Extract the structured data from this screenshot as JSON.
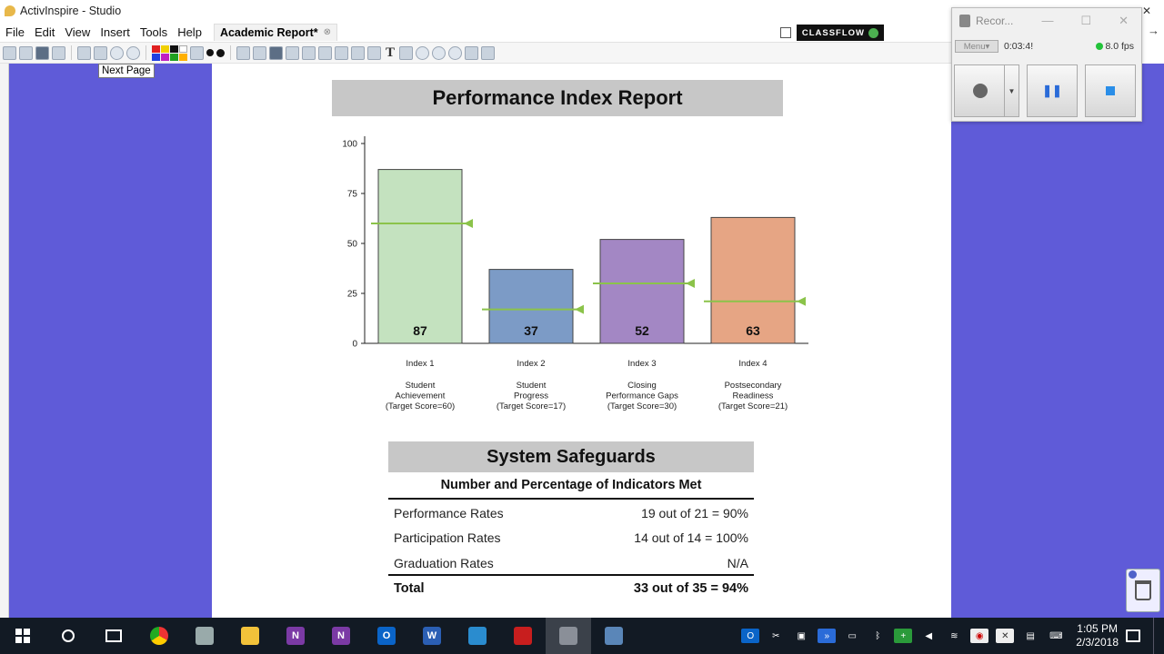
{
  "window": {
    "title": "ActivInspire - Studio"
  },
  "menu": {
    "items": [
      "File",
      "Edit",
      "View",
      "Insert",
      "Tools",
      "Help"
    ],
    "doc_tab": "Academic Report*",
    "classflow": "CLASSFLOW"
  },
  "tooltip": "Next Page",
  "report": {
    "title": "Performance Index Report"
  },
  "chart_data": {
    "type": "bar",
    "title": "Performance Index Report",
    "ylim": [
      0,
      100
    ],
    "yticks": [
      0,
      25,
      50,
      75,
      100
    ],
    "categories": [
      [
        "Index 1",
        "Student",
        "Achievement",
        "(Target Score=60)"
      ],
      [
        "Index 2",
        "Student",
        "Progress",
        "(Target Score=17)"
      ],
      [
        "Index 3",
        "Closing",
        "Performance Gaps",
        "(Target Score=30)"
      ],
      [
        "Index 4",
        "Postsecondary",
        "Readiness",
        "(Target Score=21)"
      ]
    ],
    "values": [
      87,
      37,
      52,
      63
    ],
    "targets": [
      60,
      17,
      30,
      21
    ],
    "colors": [
      "#c4e2bf",
      "#7c9bc6",
      "#a387c4",
      "#e6a584"
    ],
    "target_color": "#8bc34a",
    "grid": false
  },
  "safeguards": {
    "title": "System Safeguards",
    "subtitle": "Number and Percentage of Indicators Met",
    "rows": [
      {
        "label": "Performance Rates",
        "value": "19 out of 21 = 90%"
      },
      {
        "label": "Participation Rates",
        "value": "14 out of 14 = 100%"
      },
      {
        "label": "Graduation Rates",
        "value": "N/A"
      }
    ],
    "total": {
      "label": "Total",
      "value": "33 out of 35 = 94%"
    }
  },
  "recorder": {
    "title": "Recor...",
    "menu": "Menu",
    "time": "0:03:4!",
    "fps": "8.0 fps"
  },
  "taskbar": {
    "clock_time": "1:05 PM",
    "clock_date": "2/3/2018"
  }
}
